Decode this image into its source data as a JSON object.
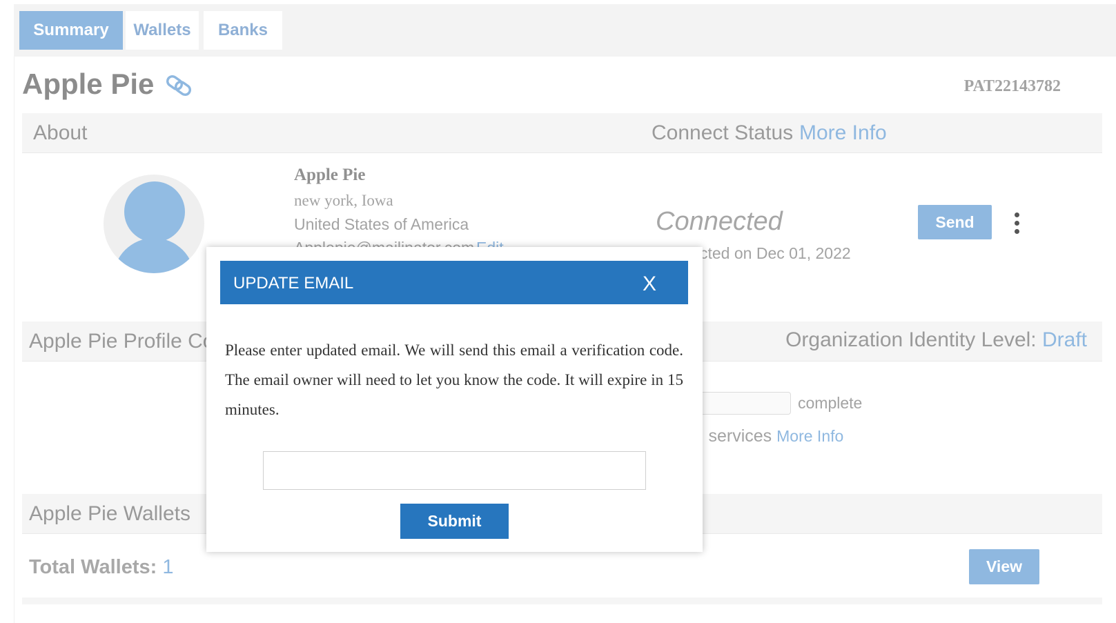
{
  "tabs": [
    {
      "label": "Summary",
      "active": true
    },
    {
      "label": "Wallets",
      "active": false
    },
    {
      "label": "Banks",
      "active": false
    }
  ],
  "header": {
    "title": "Apple Pie",
    "title_icon": "link-icon",
    "account_id": "PAT22143782"
  },
  "about": {
    "label": "About",
    "connect_status_label": "Connect Status",
    "more_info": "More Info"
  },
  "profile": {
    "name": "Apple Pie",
    "city": "new york, Iowa",
    "country": "United States of America",
    "email": "Applepie@mailinator.com",
    "edit_label": "Edit",
    "status": "Connected",
    "connected_on": "cted on Dec 01, 2022",
    "send_label": "Send"
  },
  "completion": {
    "label": "Apple Pie Profile Cor",
    "org_identity_label": "Organization Identity Level:",
    "org_identity_value": "Draft",
    "complete_label": "complete",
    "services_label": "l services",
    "services_more": "More Info"
  },
  "wallets": {
    "label": "Apple Pie Wallets",
    "total_label": "Total Wallets:",
    "total_value": "1",
    "view_label": "View"
  },
  "modal": {
    "title": "UPDATE EMAIL",
    "close_label": "X",
    "body": "Please enter updated email. We will send this email a verification code. The email owner will need to let you know the code. It will expire in 15 minutes.",
    "input_value": "",
    "submit_label": "Submit"
  },
  "colors": {
    "accent": "#8fb8e0",
    "primary": "#2776be",
    "text_muted": "#a3a3a3"
  }
}
